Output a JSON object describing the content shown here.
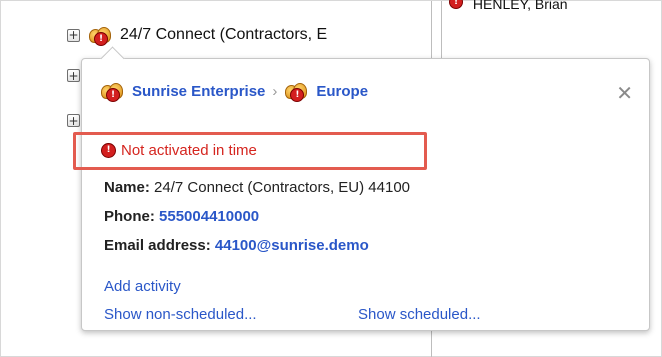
{
  "tree": {
    "row1_label": "24/7 Connect (Contractors, E",
    "top_right_name": "HENLEY, Brian",
    "expand_symbol": "+"
  },
  "popup": {
    "breadcrumb": [
      "Sunrise Enterprise",
      "Europe"
    ],
    "breadcrumb_separator": "›",
    "close_symbol": "✕",
    "status_text": "Not activated in time",
    "status_color": "#d5251f",
    "name_label": "Name:",
    "name_value": "24/7 Connect (Contractors, EU) 44100",
    "phone_label": "Phone:",
    "phone_value": "555004410000",
    "email_label": "Email address:",
    "email_value": "44100@sunrise.demo",
    "actions": {
      "add_activity": "Add activity",
      "show_non_scheduled": "Show non-scheduled...",
      "show_scheduled": "Show scheduled..."
    },
    "link_color": "#2a57c8",
    "highlight_color": "#e35b4f"
  },
  "icons": {
    "group": "group-icon",
    "error_badge": "error-badge-icon",
    "close": "close-icon",
    "expand": "expand-icon"
  }
}
